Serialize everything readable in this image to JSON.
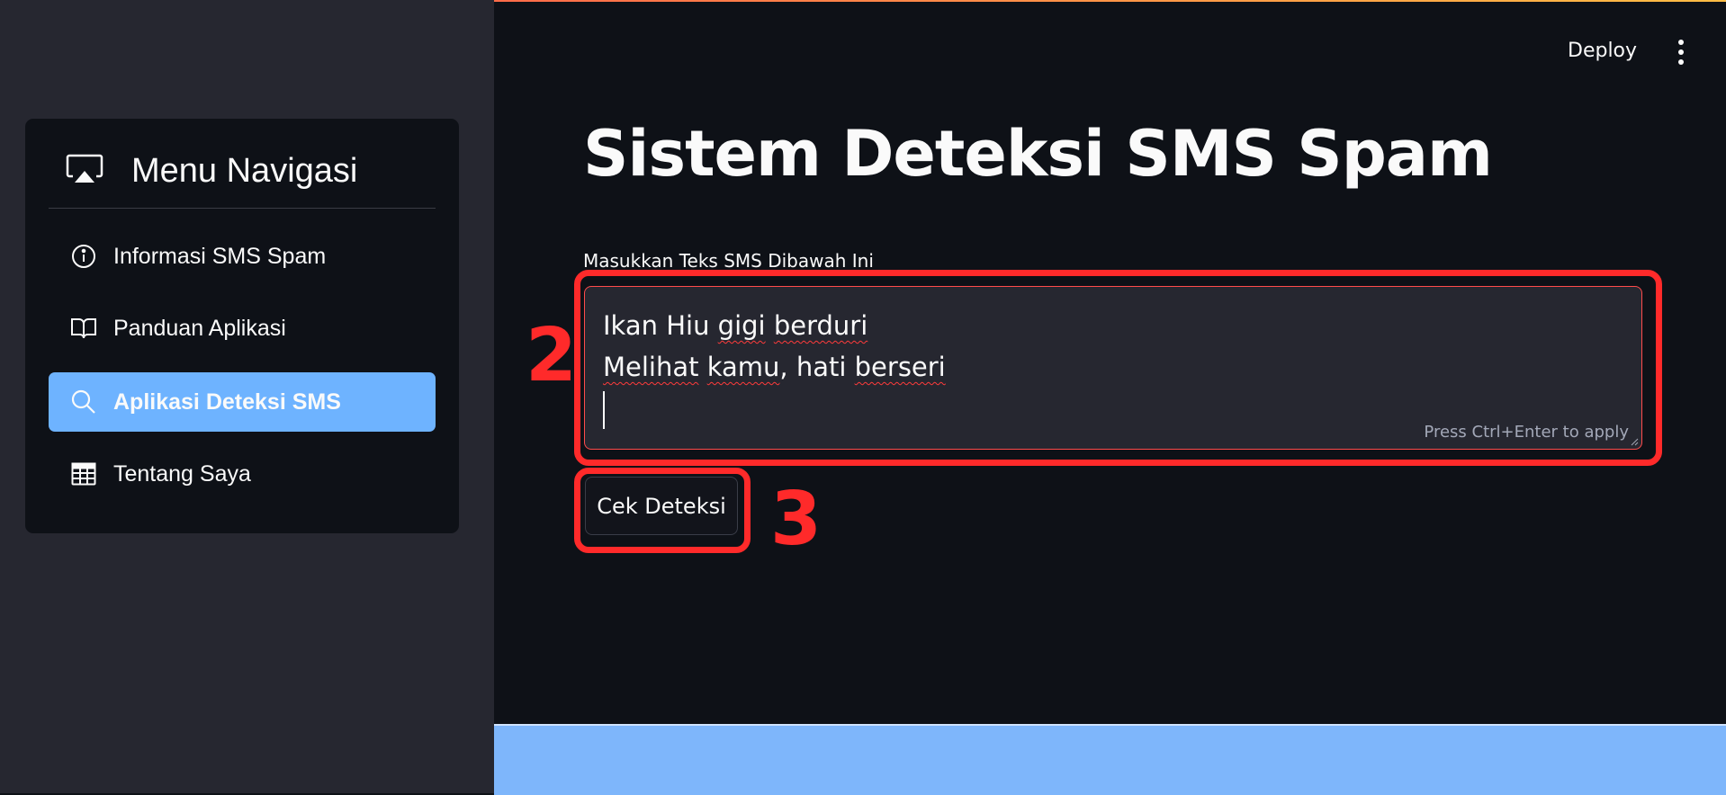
{
  "sidebar": {
    "title": "Menu Navigasi",
    "title_icon": "airplay-icon",
    "items": [
      {
        "label": "Informasi SMS Spam",
        "icon": "info-circle-icon",
        "active": false
      },
      {
        "label": "Panduan Aplikasi",
        "icon": "book-open-icon",
        "active": false
      },
      {
        "label": "Aplikasi Deteksi SMS",
        "icon": "search-icon",
        "active": true
      },
      {
        "label": "Tentang Saya",
        "icon": "table-icon",
        "active": false
      }
    ],
    "active_color": "#6eb3ff"
  },
  "header": {
    "deploy_label": "Deploy",
    "menu_icon": "kebab-menu-icon"
  },
  "main": {
    "title": "Sistem Deteksi SMS Spam",
    "input_label": "Masukkan Teks SMS Dibawah Ini",
    "textarea_lines": [
      "Ikan Hiu gigi berduri",
      "Melihat kamu, hati berseri"
    ],
    "textarea_line1_parts": [
      "Ikan Hiu ",
      "gigi",
      " ",
      "berduri"
    ],
    "textarea_line2_parts": [
      "Melihat",
      " ",
      "kamu",
      ", hati ",
      "berseri"
    ],
    "textarea_hint": "Press Ctrl+Enter to apply",
    "button_label": "Cek Deteksi"
  },
  "annotations": {
    "label_2": "2",
    "label_3": "3",
    "color": "#ff2a2a"
  }
}
